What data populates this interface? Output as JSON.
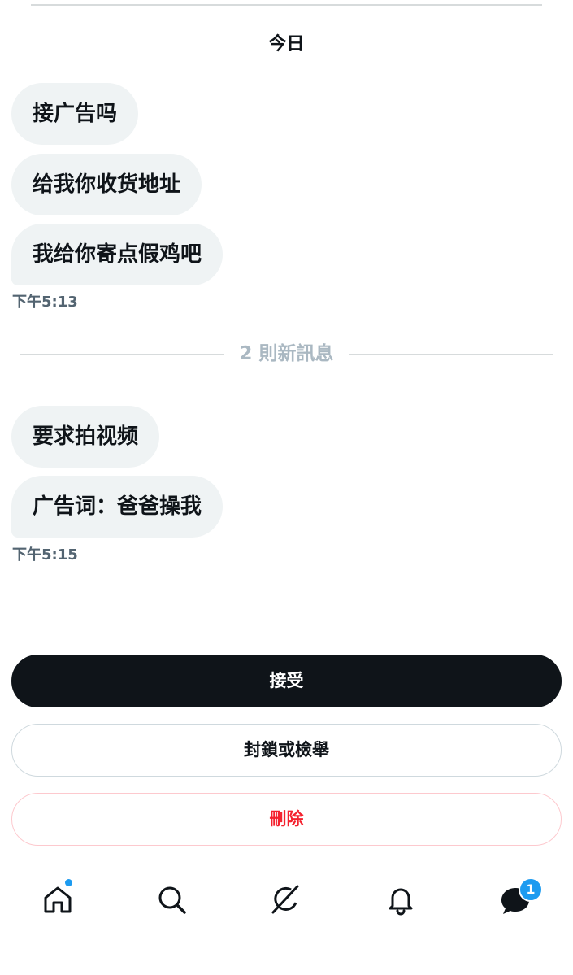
{
  "conversation": {
    "day_label": "今日",
    "messages_group_1": [
      {
        "text": "接广告吗"
      },
      {
        "text": "给我你收货地址"
      },
      {
        "text": "我给你寄点假鸡吧"
      }
    ],
    "timestamp_1": "下午5:13",
    "new_messages_label": "2 則新訊息",
    "messages_group_2": [
      {
        "text": "要求拍视频"
      },
      {
        "text": "广告词：爸爸操我"
      }
    ],
    "timestamp_2": "下午5:15"
  },
  "actions": {
    "accept_label": "接受",
    "block_report_label": "封鎖或檢舉",
    "delete_label": "刪除"
  },
  "tabbar": {
    "items": [
      {
        "icon": "home-icon",
        "has_dot": true
      },
      {
        "icon": "search-icon"
      },
      {
        "icon": "grok-icon"
      },
      {
        "icon": "bell-icon"
      },
      {
        "icon": "messages-icon",
        "badge": "1"
      }
    ]
  },
  "colors": {
    "accent": "#1d9bf0",
    "bubble_bg": "#eff3f4",
    "danger": "#f4212e",
    "primary_button": "#0f1419"
  }
}
